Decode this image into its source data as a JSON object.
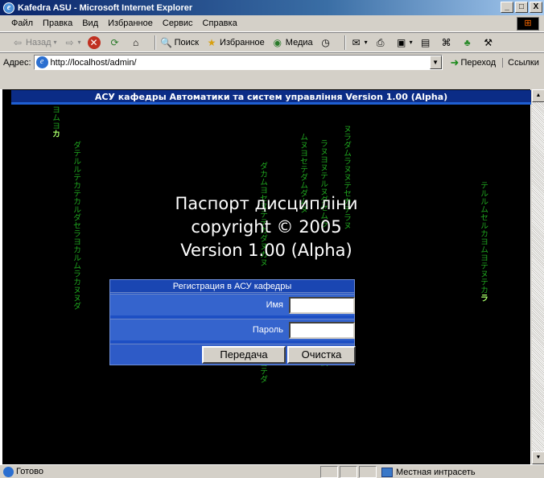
{
  "window": {
    "title": "Kafedra ASU - Microsoft Internet Explorer",
    "min": "_",
    "max": "□",
    "close": "X"
  },
  "menu": [
    "Файл",
    "Правка",
    "Вид",
    "Избранное",
    "Сервис",
    "Справка"
  ],
  "toolbar": {
    "back": "Назад",
    "search": "Поиск",
    "favorites": "Избранное",
    "media": "Медиа"
  },
  "address": {
    "label": "Адрес:",
    "url": "http://localhost/admin/",
    "go": "Переход",
    "links": "Ссылки"
  },
  "page": {
    "header": "АСУ кафедры Автоматики та систем управління Version 1.00 (Alpha)",
    "title_line1": "Паспорт дисципліни",
    "title_line2": "copyright © 2005",
    "title_line3": "Version 1.00 (Alpha)"
  },
  "login": {
    "caption": "Регистрация в АСУ кафедры",
    "name_label": "Имя",
    "name_value": "",
    "password_label": "Пароль",
    "password_value": "",
    "submit": "Передача",
    "reset": "Очистка"
  },
  "status": {
    "text": "Готово",
    "zone": "Местная интрасеть"
  },
  "colors": {
    "header_bg": "#0b2c86",
    "rain": "#1fa51f",
    "form_bg": "#1d4fc4"
  }
}
